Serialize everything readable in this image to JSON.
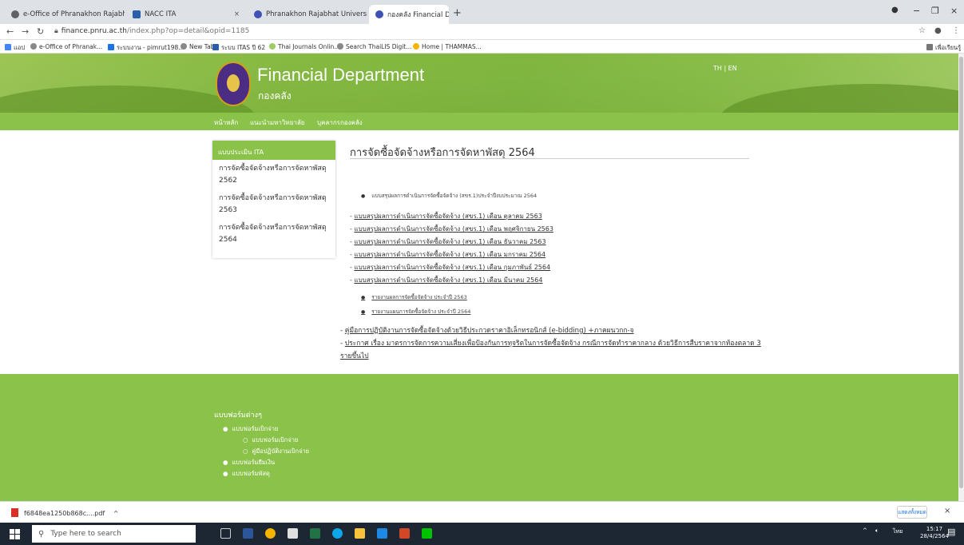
{
  "browser": {
    "tabs": [
      {
        "label": "e-Office of Phranakhon Rajabhat",
        "close": "×"
      },
      {
        "label": "NACC ITA",
        "close": "×"
      },
      {
        "label": "Phranakhon Rajabhat University",
        "close": "×"
      },
      {
        "label": "กองคลัง Financial Department",
        "close": "×"
      }
    ],
    "new_tab": "+",
    "controls": {
      "minimize": "−",
      "maximize": "❐",
      "close": "×"
    },
    "url_host": "finance.pnru.ac.th",
    "url_path": "/index.php?op=detail&opid=1185",
    "bookmarks": [
      "แอป",
      "e-Office of Phranak...",
      "ระบบงาน - pimrut198...",
      "New Tab",
      "ระบบ ITAS ปี 62",
      "Thai Journals Onlin...",
      "Search ThaiLIS Digit...",
      "Home | THAMMAS...",
      "เพื่อเรียนรู้"
    ]
  },
  "site": {
    "title": "Financial Department",
    "subtitle": "กองคลัง",
    "lang": "TH  |  EN",
    "nav": [
      "หน้าหลัก",
      "แนะนำมหาวิทยาลัย",
      "บุคลากรกองคลัง"
    ]
  },
  "sidebar": {
    "heading": "แบบประเมิน ITA",
    "items": [
      {
        "label": "การจัดซื้อจัดจ้างหรือการจัดหาพัสดุ 2562"
      },
      {
        "label": "การจัดซื้อจัดจ้างหรือการจัดหาพัสดุ 2563"
      },
      {
        "label": "การจัดซื้อจัดจ้างหรือการจัดหาพัสดุ 2564"
      }
    ]
  },
  "content": {
    "title": "การจัดซื้อจัดจ้างหรือการจัดหาพัสดุ 2564",
    "bullet_top": "แบบสรุปผลการดำเนินการจัดซื้อจัดจ้าง (สขร.1)ประจำปีงบประมาณ 2564",
    "monthly_links": [
      "แบบสรุปผลการดำเนินการจัดซื้อจัดจ้าง (สขร.1) เดือน ตุลาคม 2563",
      "แบบสรุปผลการดำเนินการจัดซื้อจัดจ้าง (สขร.1) เดือน พฤศจิกายน 2563",
      "แบบสรุปผลการดำเนินการจัดซื้อจัดจ้าง (สขร.1) เดือน ธันวาคม 2563",
      "แบบสรุปผลการดำเนินการจัดซื้อจัดจ้าง (สขร.1) เดือน มกราคม 2564",
      "แบบสรุปผลการดำเนินการจัดซื้อจัดจ้าง (สขร.1) เดือน กุมภาพันธ์ 2564",
      "แบบสรุปผลการดำเนินการจัดซื้อจัดจ้าง (สขร.1) เดือน มีนาคม 2564"
    ],
    "report_links": [
      "รายงานผลการจัดซื้อจัดจ้าง ประจำปี 2563",
      "รายงานแผนการจัดซื้อจัดจ้าง ประจำปี 2564"
    ],
    "manual_link": "คู่มือการปฏิบัติงานการจัดซื้อจัดจ้างด้วยวิธีประกวดราคาอิเล็กทรอนิกส์ (e-bidding) +ภาคผนวกก-จ",
    "announcement_link": "ประกาศ เรื่อง มาตรการจัดการความเสี่ยงเพื่อป้องกันการทุจริตในการจัดซื้อจัดจ้าง กรณีการจัดทำราคากลาง ด้วยวิธีการสืบราคาจากท้องตลาด 3 รายขึ้นไป"
  },
  "footer": {
    "title": "แบบฟอร์มต่างๆ",
    "items": [
      {
        "label": "แบบฟอร์มเบิกจ่าย",
        "level": 1
      },
      {
        "label": "แบบฟอร์มเบิกจ่าย",
        "level": 2
      },
      {
        "label": "คู่มือปฏิบัติงานเบิกจ่าย",
        "level": 2
      },
      {
        "label": "แบบฟอร์มยืมเงิน",
        "level": 1
      },
      {
        "label": "แบบฟอร์มพัสดุ",
        "level": 1
      }
    ]
  },
  "download": {
    "filename": "f6848ea1250b868c....pdf",
    "chevron": "^",
    "show_all": "แสดงทั้งหมด",
    "close": "×"
  },
  "taskbar": {
    "search_placeholder": "Type here to search",
    "lang": "ไทย",
    "time": "15:17",
    "date": "28/4/2564"
  },
  "colors": {
    "site_green": "#8bc34a",
    "chrome_tabbar": "#dee1e6",
    "taskbar": "#1c2733"
  }
}
